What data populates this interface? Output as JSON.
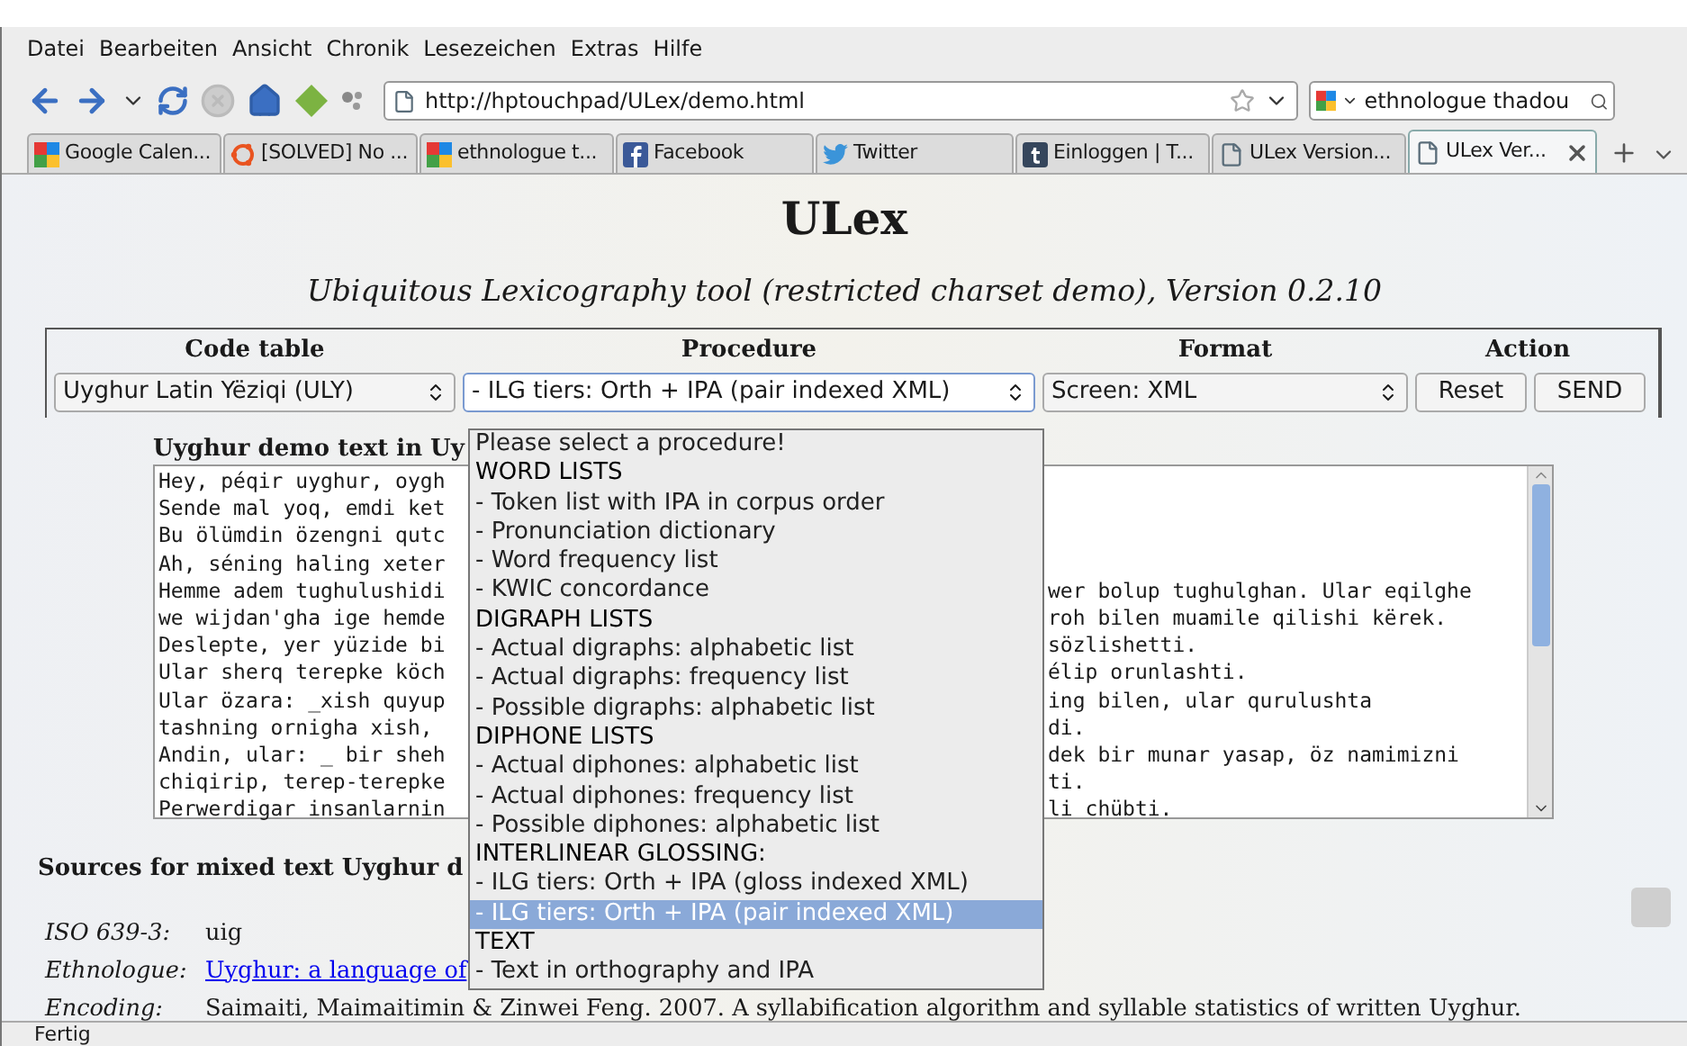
{
  "menu": [
    "Datei",
    "Bearbeiten",
    "Ansicht",
    "Chronik",
    "Lesezeichen",
    "Extras",
    "Hilfe"
  ],
  "address": "http://hptouchpad/ULex/demo.html",
  "search": "ethnologue thadou",
  "tabs": [
    {
      "label": "Google Calen...",
      "kind": "google",
      "selected": false
    },
    {
      "label": "[SOLVED] No ...",
      "kind": "ubuntu",
      "selected": false
    },
    {
      "label": "ethnologue t...",
      "kind": "google",
      "selected": false
    },
    {
      "label": "Facebook",
      "kind": "facebook",
      "selected": false
    },
    {
      "label": "Twitter",
      "kind": "twitter",
      "selected": false
    },
    {
      "label": "Einloggen | T...",
      "kind": "tumblr",
      "selected": false
    },
    {
      "label": "ULex Version...",
      "kind": "page",
      "selected": false
    },
    {
      "label": "ULex Ver...",
      "kind": "page",
      "selected": true
    }
  ],
  "title": "ULex",
  "subtitle": "Ubiquitous Lexicography tool (restricted charset demo), Version 0.2.10",
  "form": {
    "headers": [
      "Code table",
      "Procedure",
      "Format",
      "Action"
    ],
    "code_table": "Uyghur Latin Yëziqi (ULY)",
    "procedure": "- ILG tiers: Orth + IPA (pair indexed XML)",
    "format": "Screen: XML",
    "buttons": [
      "Reset",
      "SEND"
    ]
  },
  "procedure_options": [
    {
      "label": "Please select a procedure!",
      "kind": "option",
      "selected": false
    },
    {
      "label": "WORD LISTS",
      "kind": "group",
      "selected": false
    },
    {
      "label": "- Token list with IPA in corpus order",
      "kind": "option",
      "selected": false
    },
    {
      "label": "- Pronunciation dictionary",
      "kind": "option",
      "selected": false
    },
    {
      "label": "- Word frequency list",
      "kind": "option",
      "selected": false
    },
    {
      "label": "- KWIC concordance",
      "kind": "option",
      "selected": false
    },
    {
      "label": "DIGRAPH LISTS",
      "kind": "group",
      "selected": false
    },
    {
      "label": "- Actual digraphs: alphabetic list",
      "kind": "option",
      "selected": false
    },
    {
      "label": "- Actual digraphs: frequency list",
      "kind": "option",
      "selected": false
    },
    {
      "label": "- Possible digraphs: alphabetic list",
      "kind": "option",
      "selected": false
    },
    {
      "label": "DIPHONE LISTS",
      "kind": "group",
      "selected": false
    },
    {
      "label": "- Actual diphones: alphabetic list",
      "kind": "option",
      "selected": false
    },
    {
      "label": "- Actual diphones: frequency list",
      "kind": "option",
      "selected": false
    },
    {
      "label": "- Possible diphones: alphabetic list",
      "kind": "option",
      "selected": false
    },
    {
      "label": "INTERLINEAR GLOSSING:",
      "kind": "group",
      "selected": false
    },
    {
      "label": "- ILG tiers: Orth + IPA (gloss indexed XML)",
      "kind": "option",
      "selected": false
    },
    {
      "label": "- ILG tiers: Orth + IPA (pair indexed XML)",
      "kind": "option",
      "selected": true
    },
    {
      "label": "TEXT",
      "kind": "group",
      "selected": false
    },
    {
      "label": "- Text in orthography and IPA",
      "kind": "option",
      "selected": false
    }
  ],
  "demo_label": "Uyghur demo text in Uy",
  "demo_lines": [
    {
      "left": "Hey, péqir uyghur, oygh"
    },
    {
      "left": "Sende mal yoq, emdi ket"
    },
    {
      "left": "Bu ölümdin özengni qutc"
    },
    {
      "left": "Ah, séning haling xeter"
    },
    {
      "left": "Hemme adem tughulushidi",
      "right": "wer bolup tughulghan. Ular eqilghe"
    },
    {
      "left": "we wijdan'gha ige hemde",
      "right": "roh bilen muamile qilishi kërek."
    },
    {
      "left": "Deslepte, yer yüzide bi",
      "right": "sözlishetti."
    },
    {
      "left": "Ular sherq terepke köch",
      "right": "élip orunlashti."
    },
    {
      "left": "Ular özara: _xish quyup",
      "right": "ing bilen, ular qurulushta"
    },
    {
      "left": "tashning ornigha xish,",
      "right": "di."
    },
    {
      "left": "Andin, ular: _ bir sheh",
      "right": "dek bir munar yasap, öz namimizni"
    },
    {
      "left": "chiqirip, terep-terepke",
      "right": "ti."
    },
    {
      "left": "Perwerdigar insanlarnin",
      "right": "li chübti."
    }
  ],
  "sources_heading": "Sources for mixed text Uyghur d",
  "sources": [
    {
      "label": "ISO 639-3:",
      "value": "uig",
      "kind": "text"
    },
    {
      "label": "Ethnologue:",
      "value": "Uyghur: a language of",
      "kind": "link"
    },
    {
      "label": "Encoding:",
      "value": "Saimaiti, Maimaitimin & Zinwei Feng. 2007. A syllabification algorithm and syllable statistics of written Uyghur.",
      "kind": "text"
    }
  ],
  "status": "Fertig"
}
